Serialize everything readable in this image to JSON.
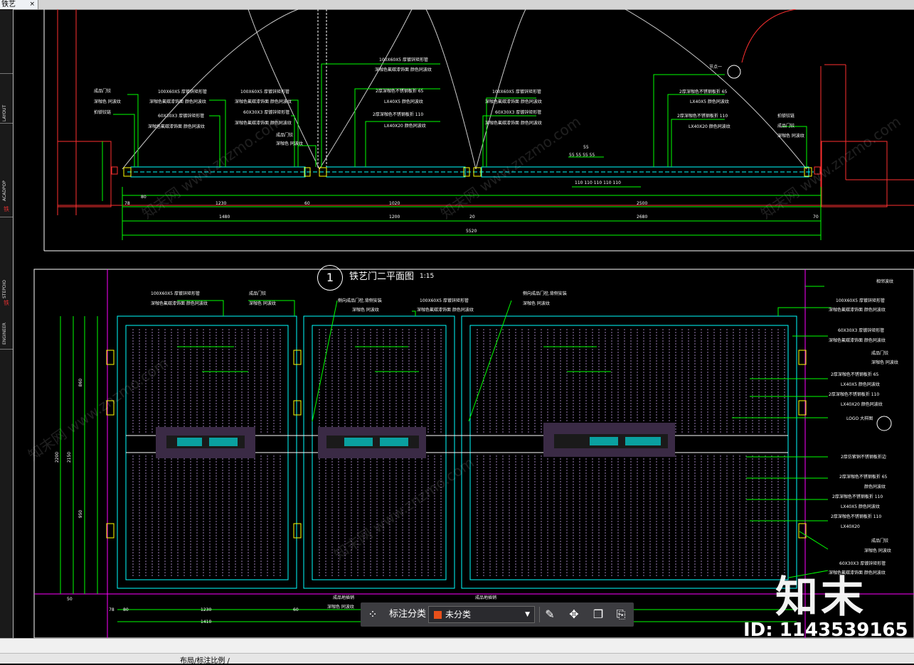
{
  "tab": {
    "label": "铁艺",
    "close": "×"
  },
  "sidebar": {
    "labels": [
      "LAYOUT",
      "ACADPOP",
      "STEPDIO",
      "ENGINEER"
    ],
    "marks": [
      "铁",
      "铁",
      "铁"
    ]
  },
  "drawing": {
    "title_num": "1",
    "title": "铁艺门二平面图",
    "scale": "1:15",
    "top_dims": [
      "1230",
      "1020",
      "2500",
      "1480",
      "1200",
      "2680",
      "5520",
      "55",
      "55 55 55 55",
      "110 110 110 110 110",
      "78",
      "80",
      "60",
      "20",
      "70"
    ],
    "elev_dims": [
      "1230",
      "1410",
      "2200",
      "2150",
      "950",
      "860",
      "78",
      "80",
      "60",
      "50"
    ],
    "top_labels": [
      "成品门铰",
      "深咖色 同波纹",
      "拍锁铰链",
      "100X60X5  厚镀锌矩形管",
      "深咖色氟碳漆饰面 颜色同波纹",
      "60X30X3  厚镀锌矩形管",
      "深咖色氟碳漆饰面 颜色同波纹",
      "100X60X5  厚镀锌矩形管",
      "深咖色氟碳漆饰面 颜色同波纹",
      "60X30X3 厚镀锌矩形管",
      "深咖色氟碳漆饰面 颜色同波纹",
      "成品门铰",
      "深咖色 同波纹",
      "100X60X5  厚镀锌矩形管",
      "深咖色氟碳漆饰面 颜色同波纹",
      "2厚深咖色不锈钢板折 65",
      "LX40X5   颜色同波纹",
      "2厚深咖色不锈钢板折 110",
      "LX40X20   颜色同波纹",
      "100X60X5  厚镀锌矩形管",
      "深咖色氟碳漆饰面 颜色同波纹",
      "60X30X3  厚镀锌矩形管",
      "深咖色氟碳漆饰面 颜色同波纹",
      "节点一",
      "2厚深咖色不锈钢板折 65",
      "LX40X5   颜色同波纹",
      "2厚深咖色不锈钢板折 110",
      "LX40X20   颜色同波纹",
      "拍锁铰链",
      "成品门铰",
      "深咖色 同波纹"
    ],
    "elev_labels_left": [
      "100X60X5   厚镀锌矩形管",
      "深咖色氟碳漆饰面 颜色同波纹",
      "成品门铰",
      "深咖色 同波纹",
      "侧向成品门栓,背侧安装",
      "深咖色 同波纹",
      "100X60X5  厚镀锌矩形管",
      "深咖色氟碳漆饰面 颜色同波纹",
      "侧向成品门栓,背侧安装",
      "深咖色 同波纹"
    ],
    "elev_labels_right": [
      "相邻波纹",
      "100X60X5   厚镀锌矩形管",
      "深咖色氟碳漆饰面 颜色同波纹",
      "60X30X3   厚镀锌矩形管",
      "深咖色氟碳漆饰面 颜色同波纹",
      "成品门铰",
      "深咖色 同波纹",
      "2厚深咖色不锈钢板折 65",
      "LX40X5   颜色同波纹",
      "2厚深咖色不锈钢板折 110",
      "LX40X20   颜色同波纹",
      "LOGO  大样图",
      "2厚仿紫铜不锈钢板折边",
      "2厚深咖色不锈钢板折 65",
      "颜色同波纹",
      "2厚深咖色不锈钢板折 110",
      "LX40X5   颜色同波纹",
      "2厚深咖色不锈钢板折 110",
      "LX40X20",
      "成品门铰",
      "深咖色 同波纹",
      "60X30X3   厚镀锌矩形管",
      "深咖色氟碳漆饰面 颜色同波纹"
    ],
    "bottom_labels": [
      "成品地插销",
      "深咖色 同波纹",
      "成品地插销"
    ]
  },
  "toolbar": {
    "category_label": "标注分类",
    "selected": "未分类",
    "swatch_color": "#e8501a",
    "icons": [
      "grid-icon",
      "edit-icon",
      "move-icon",
      "copy-icon",
      "paste-icon"
    ]
  },
  "status": {
    "text": "布局/标注比例 /"
  },
  "watermark": {
    "logo": "知末",
    "id": "ID: 1143539165",
    "faint": "知末网 www.znzmo.com"
  },
  "colors": {
    "background": "#000000",
    "green": "#00ff00",
    "cyan": "#00ffff",
    "red": "#ff3030",
    "yellow": "#ffff00",
    "magenta": "#ff00ff"
  }
}
